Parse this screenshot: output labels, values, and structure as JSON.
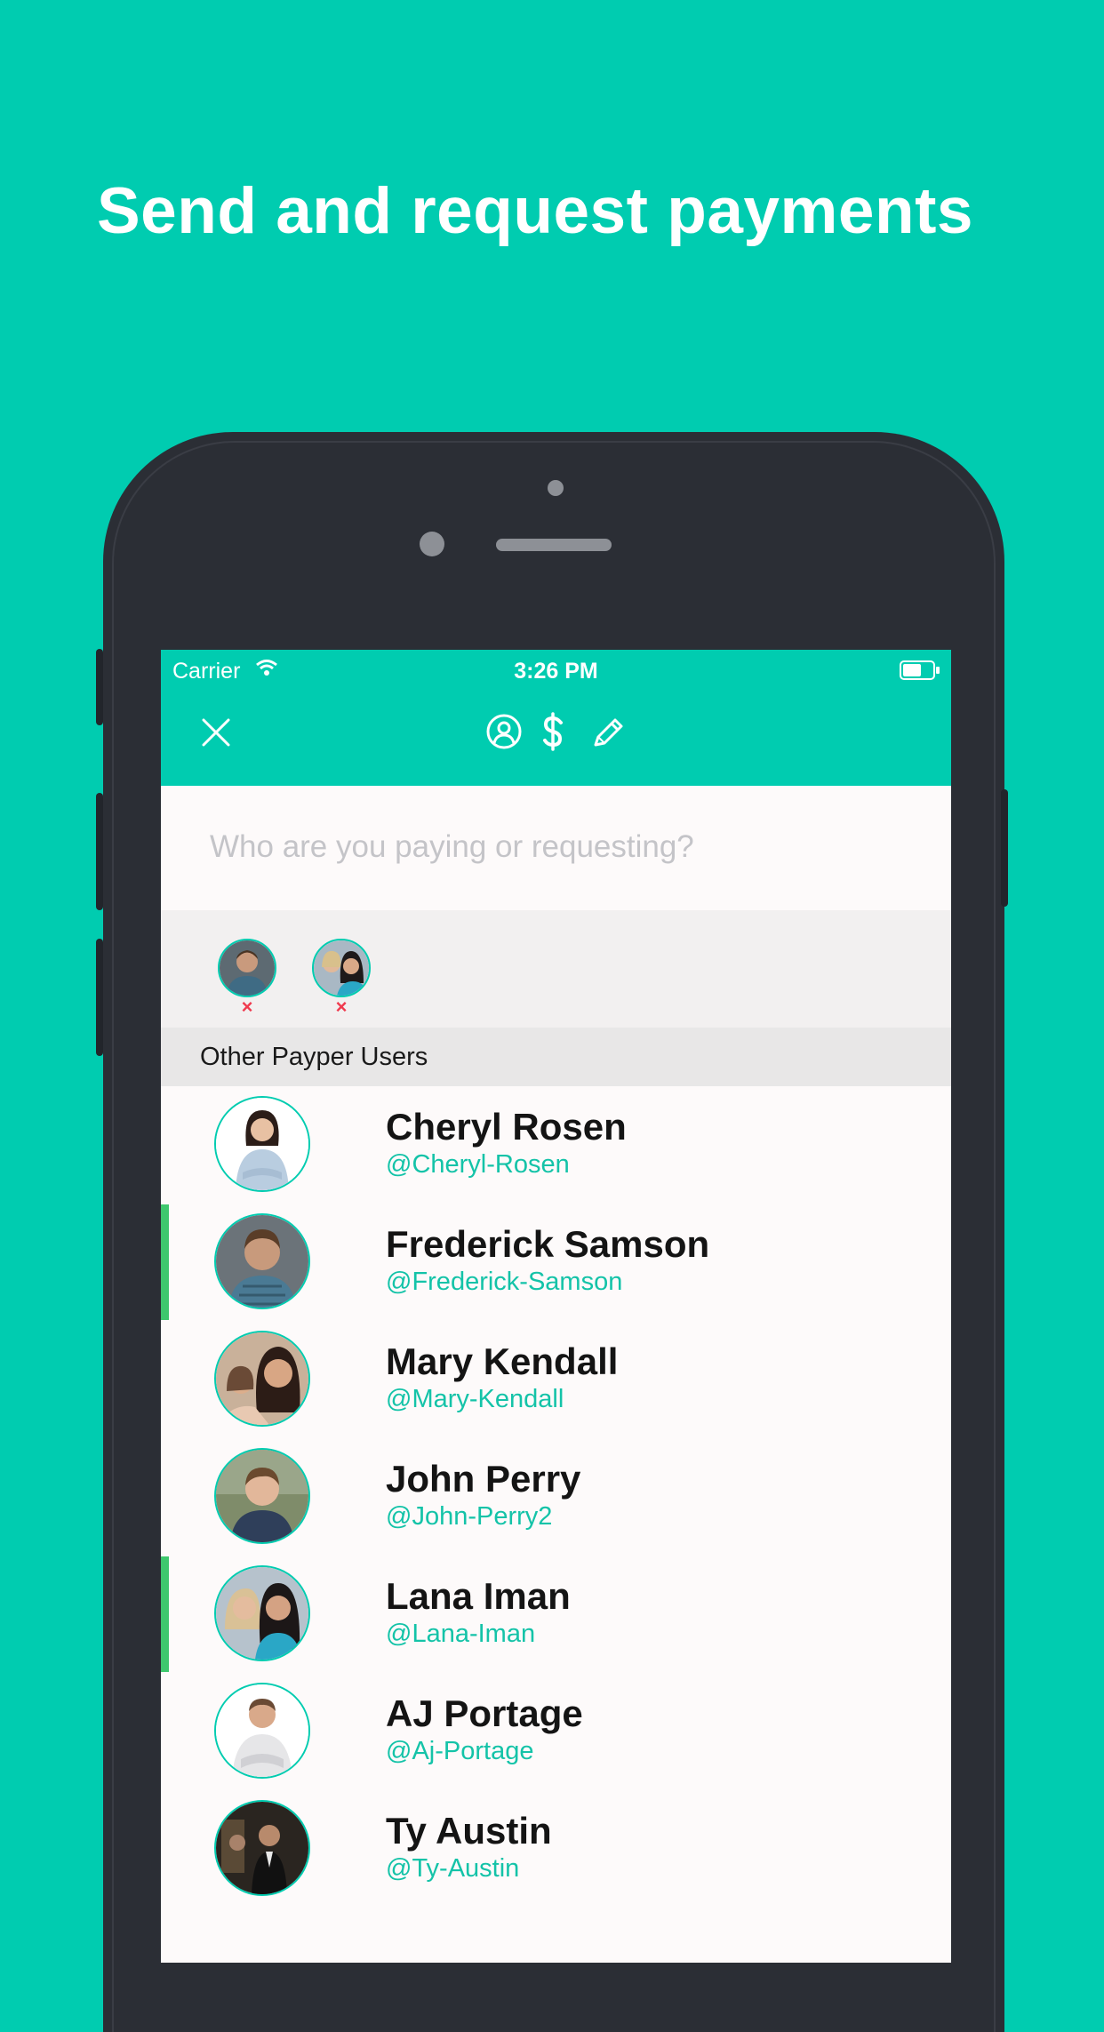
{
  "promo": {
    "headline": "Send and request payments"
  },
  "status_bar": {
    "carrier": "Carrier",
    "time": "3:26 PM"
  },
  "nav": {
    "close_icon": "close-icon",
    "icons": [
      "user-icon",
      "dollar-icon",
      "pencil-icon"
    ]
  },
  "search": {
    "placeholder": "Who are you paying or requesting?",
    "value": ""
  },
  "selected_recipients": [
    {
      "avatar": "avatar-frederick",
      "remove_label": "×"
    },
    {
      "avatar": "avatar-lana",
      "remove_label": "×"
    }
  ],
  "section": {
    "title": "Other Payper Users"
  },
  "users": [
    {
      "name": "Cheryl Rosen",
      "handle": "@Cheryl-Rosen",
      "selected": false
    },
    {
      "name": "Frederick Samson",
      "handle": "@Frederick-Samson",
      "selected": true
    },
    {
      "name": "Mary Kendall",
      "handle": "@Mary-Kendall",
      "selected": false
    },
    {
      "name": "John Perry",
      "handle": "@John-Perry2",
      "selected": false
    },
    {
      "name": "Lana Iman",
      "handle": "@Lana-Iman",
      "selected": true
    },
    {
      "name": "AJ Portage",
      "handle": "@Aj-Portage",
      "selected": false
    },
    {
      "name": "Ty Austin",
      "handle": "@Ty-Austin",
      "selected": false
    }
  ],
  "colors": {
    "brand": "#00ccb0",
    "handle": "#14c3a8",
    "selected_indicator": "#3ec86e",
    "remove": "#f03a4e"
  }
}
